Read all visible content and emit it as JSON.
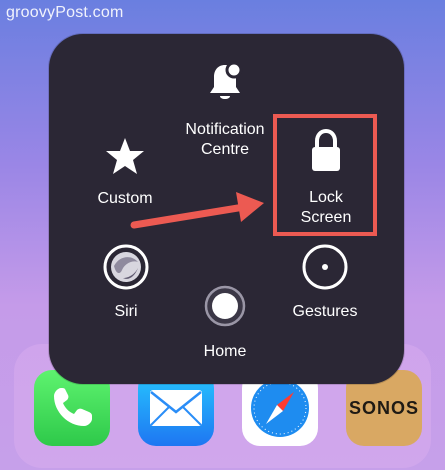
{
  "watermark": "groovyPost.com",
  "menu": {
    "items": [
      {
        "id": "notification",
        "label": "Notification\nCentre",
        "icon": "bell-icon"
      },
      {
        "id": "custom",
        "label": "Custom",
        "icon": "star-icon"
      },
      {
        "id": "lock",
        "label": "Lock\nScreen",
        "icon": "lock-icon"
      },
      {
        "id": "siri",
        "label": "Siri",
        "icon": "siri-icon"
      },
      {
        "id": "gestures",
        "label": "Gestures",
        "icon": "gestures-icon"
      },
      {
        "id": "home",
        "label": "Home",
        "icon": "home-button-icon"
      }
    ]
  },
  "dock": {
    "apps": [
      {
        "name": "Phone",
        "icon": "phone-icon"
      },
      {
        "name": "Mail",
        "icon": "mail-icon"
      },
      {
        "name": "Safari",
        "icon": "compass-icon"
      },
      {
        "name": "Sonos",
        "label": "SONOS"
      }
    ]
  },
  "annotation": {
    "highlight_color": "#ec5a52",
    "arrow_color": "#ec5a52"
  },
  "colors": {
    "menu_background": "#2b2735",
    "menu_text": "#ffffff"
  }
}
